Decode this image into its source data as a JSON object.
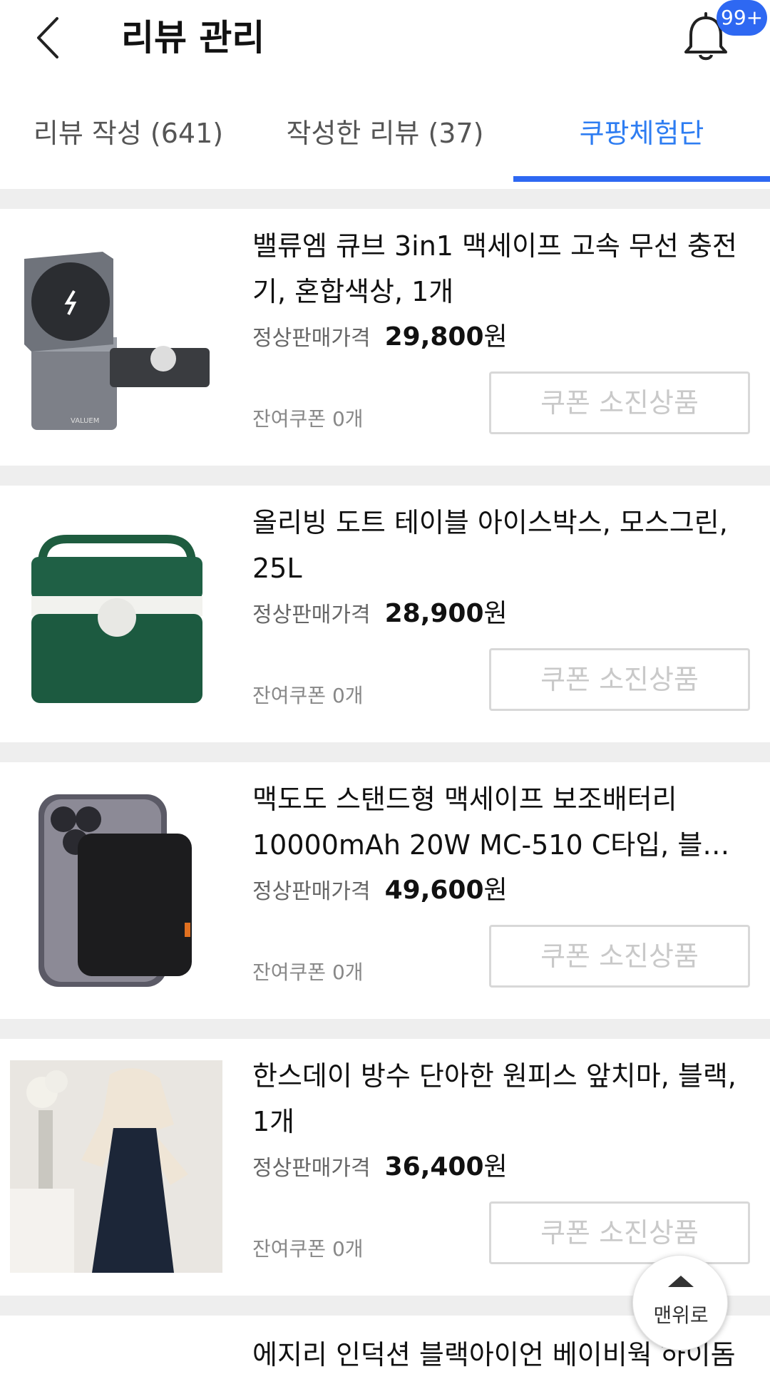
{
  "header": {
    "title": "리뷰 관리",
    "notification_badge": "99+"
  },
  "tabs": [
    {
      "label": "리뷰 작성 (641)",
      "active": false
    },
    {
      "label": "작성한 리뷰 (37)",
      "active": false
    },
    {
      "label": "쿠팡체험단",
      "active": true
    }
  ],
  "price_label": "정상판매가격",
  "currency_suffix": "원",
  "products": [
    {
      "name": "밸류엠 큐브 3in1 맥세이프 고속 무선 충전기, 혼합색상, 1개",
      "price": "29,800",
      "remaining_coupons": "잔여쿠폰 0개",
      "button": "쿠폰 소진상품",
      "image": "wireless-charger-image"
    },
    {
      "name": "올리빙 도트 테이블 아이스박스, 모스그린, 25L",
      "price": "28,900",
      "remaining_coupons": "잔여쿠폰 0개",
      "button": "쿠폰 소진상품",
      "image": "icebox-image"
    },
    {
      "name": "맥도도 스탠드형 맥세이프 보조배터리 10000mAh 20W MC-510 C타입, 블랙,...",
      "price": "49,600",
      "remaining_coupons": "잔여쿠폰 0개",
      "button": "쿠폰 소진상품",
      "image": "power-bank-image"
    },
    {
      "name": "한스데이 방수 단아한 원피스 앞치마, 블랙, 1개",
      "price": "36,400",
      "remaining_coupons": "잔여쿠폰 0개",
      "button": "쿠폰 소진상품",
      "image": "apron-image"
    }
  ],
  "partial_product": {
    "name": "에지리 인덕션 블랙아이언 베이비웍 하이돔"
  },
  "scroll_top": {
    "label": "맨위로"
  },
  "colors": {
    "accent": "#2e68f2",
    "badge": "#2e68f2",
    "divider": "#eeeeee"
  }
}
